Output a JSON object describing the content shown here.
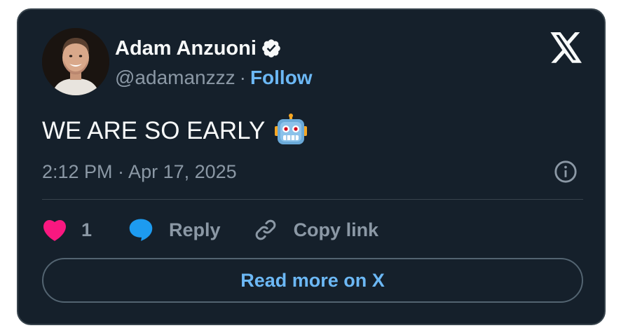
{
  "author": {
    "display_name": "Adam Anzuoni",
    "handle": "@adamanzzz",
    "separator": "·",
    "follow_label": "Follow",
    "verified_icon": "verified-badge-icon",
    "avatar": "avatar-photo"
  },
  "tweet": {
    "text": "WE ARE SO EARLY",
    "emoji_icon": "robot-face-icon",
    "timestamp": "2:12 PM · Apr 17, 2025"
  },
  "actions": {
    "like_count": "1",
    "reply_label": "Reply",
    "copy_link_label": "Copy link"
  },
  "footer": {
    "read_more_label": "Read more on X"
  },
  "icons": {
    "logo": "x-logo-icon",
    "info": "info-icon",
    "like": "heart-icon",
    "reply": "speech-bubble-icon",
    "copy": "link-icon"
  },
  "colors": {
    "card_background": "#15202b",
    "border": "#38444d",
    "text_primary": "#f7f9f9",
    "text_secondary": "#8b98a5",
    "link_blue": "#6cb8f5",
    "heart_pink": "#f91880"
  }
}
